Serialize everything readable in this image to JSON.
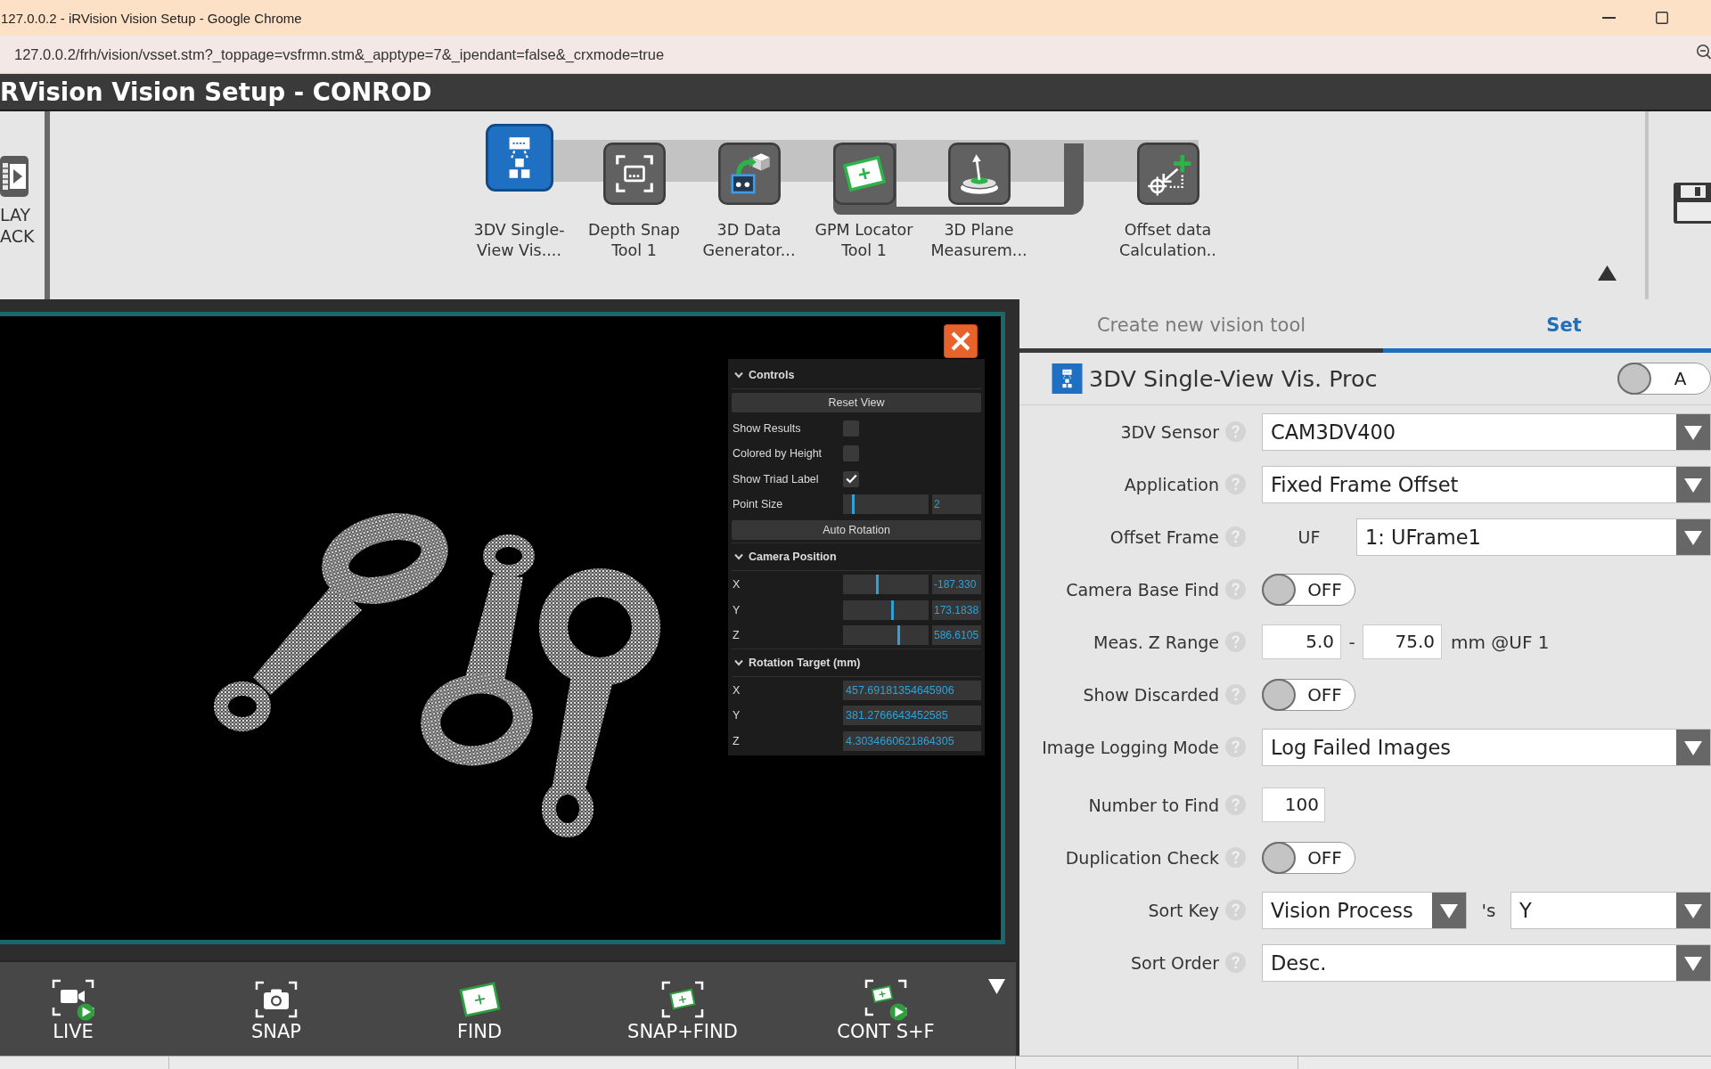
{
  "browser": {
    "title": "127.0.0.2 - iRVision Vision Setup - Google Chrome",
    "url": "127.0.0.2/frh/vision/vsset.stm?_toppage=vsfrmn.stm&_apptype=7&_ipendant=false&_crxmode=true"
  },
  "app": {
    "title": "RVision Vision Setup - CONROD"
  },
  "toolbar": {
    "playback": {
      "label": "LAY ACK"
    },
    "tools": [
      {
        "kind": "single-view-process",
        "label": "3DV Single-View Vis....",
        "selected": true
      },
      {
        "kind": "depth-snap",
        "label": "Depth Snap Tool 1",
        "selected": false
      },
      {
        "kind": "data-generator",
        "label": "3D Data Generator...",
        "selected": false
      },
      {
        "kind": "locator",
        "label": "GPM Locator Tool 1",
        "selected": false,
        "children": [
          {
            "kind": "plane-measurement",
            "label": "3D Plane Measurem...",
            "selected": false
          }
        ]
      },
      {
        "kind": "offset-calculation",
        "label": "Offset data Calculation..",
        "selected": false
      }
    ]
  },
  "viewer": {
    "controls": [
      {
        "title": "Controls",
        "expanded": true,
        "items": [
          {
            "kind": "button",
            "label": "Reset View"
          },
          {
            "kind": "checkbox",
            "label": "Show Results",
            "checked": false
          },
          {
            "kind": "checkbox",
            "label": "Colored by Height",
            "checked": false
          },
          {
            "kind": "checkbox",
            "label": "Show Triad Label",
            "checked": true
          },
          {
            "kind": "slider",
            "label": "Point Size",
            "level": 0.12,
            "value": "2"
          },
          {
            "kind": "button",
            "label": "Auto Rotation"
          }
        ]
      },
      {
        "title": "Camera Position",
        "expanded": true,
        "items": [
          {
            "kind": "slider",
            "label": "X",
            "level": 0.4,
            "value": "-187.330"
          },
          {
            "kind": "slider",
            "label": "Y",
            "level": 0.58,
            "value": "173.1838"
          },
          {
            "kind": "slider",
            "label": "Z",
            "level": 0.65,
            "value": "586.6105"
          }
        ]
      },
      {
        "title": "Rotation Target (mm)",
        "expanded": true,
        "items": [
          {
            "kind": "text",
            "label": "X",
            "value": "457.69181354645906"
          },
          {
            "kind": "text",
            "label": "Y",
            "value": "381.2766643452585"
          },
          {
            "kind": "text",
            "label": "Z",
            "value": "4.3034660621864305"
          }
        ]
      }
    ]
  },
  "actions": [
    {
      "kind": "live",
      "label": "LIVE"
    },
    {
      "kind": "snap",
      "label": "SNAP"
    },
    {
      "kind": "find",
      "label": "FIND"
    },
    {
      "kind": "snap-find",
      "label": "SNAP+FIND"
    },
    {
      "kind": "cont-snap-find",
      "label": "CONT S+F"
    }
  ],
  "settings": {
    "tabs": [
      {
        "label": "Create new vision tool",
        "selected": false
      },
      {
        "label": "Set",
        "selected": true
      }
    ],
    "header": {
      "title": "3DV Single-View Vis. Proc",
      "toggle": {
        "label": "A",
        "on": false
      }
    },
    "groups": [
      {
        "rows": [
          {
            "kind": "dropdown",
            "label": "3DV Sensor",
            "value": "CAM3DV400"
          },
          {
            "kind": "dropdown",
            "label": "Application",
            "value": "Fixed Frame Offset"
          },
          {
            "kind": "frame-dropdown",
            "label": "Offset Frame",
            "prefix": "UF",
            "value": "1: UFrame1"
          },
          {
            "kind": "toggle",
            "label": "Camera Base Find",
            "on": false,
            "state_label": "OFF"
          },
          {
            "kind": "range",
            "label": "Meas. Z Range",
            "from": "5.0",
            "separator": "-",
            "to": "75.0",
            "unit": "mm @UF 1"
          },
          {
            "kind": "toggle",
            "label": "Show Discarded",
            "on": false,
            "state_label": "OFF"
          },
          {
            "kind": "dropdown",
            "label": "Image Logging Mode",
            "value": "Log Failed Images"
          }
        ]
      },
      {
        "rows": [
          {
            "kind": "number",
            "label": "Number to Find",
            "value": "100"
          },
          {
            "kind": "toggle",
            "label": "Duplication Check",
            "on": false,
            "state_label": "OFF"
          },
          {
            "kind": "key-dropdown",
            "label": "Sort Key",
            "value": "Vision Process",
            "joiner": "'s",
            "value2": "Y"
          },
          {
            "kind": "dropdown",
            "label": "Sort Order",
            "value": "Desc."
          }
        ]
      }
    ]
  }
}
